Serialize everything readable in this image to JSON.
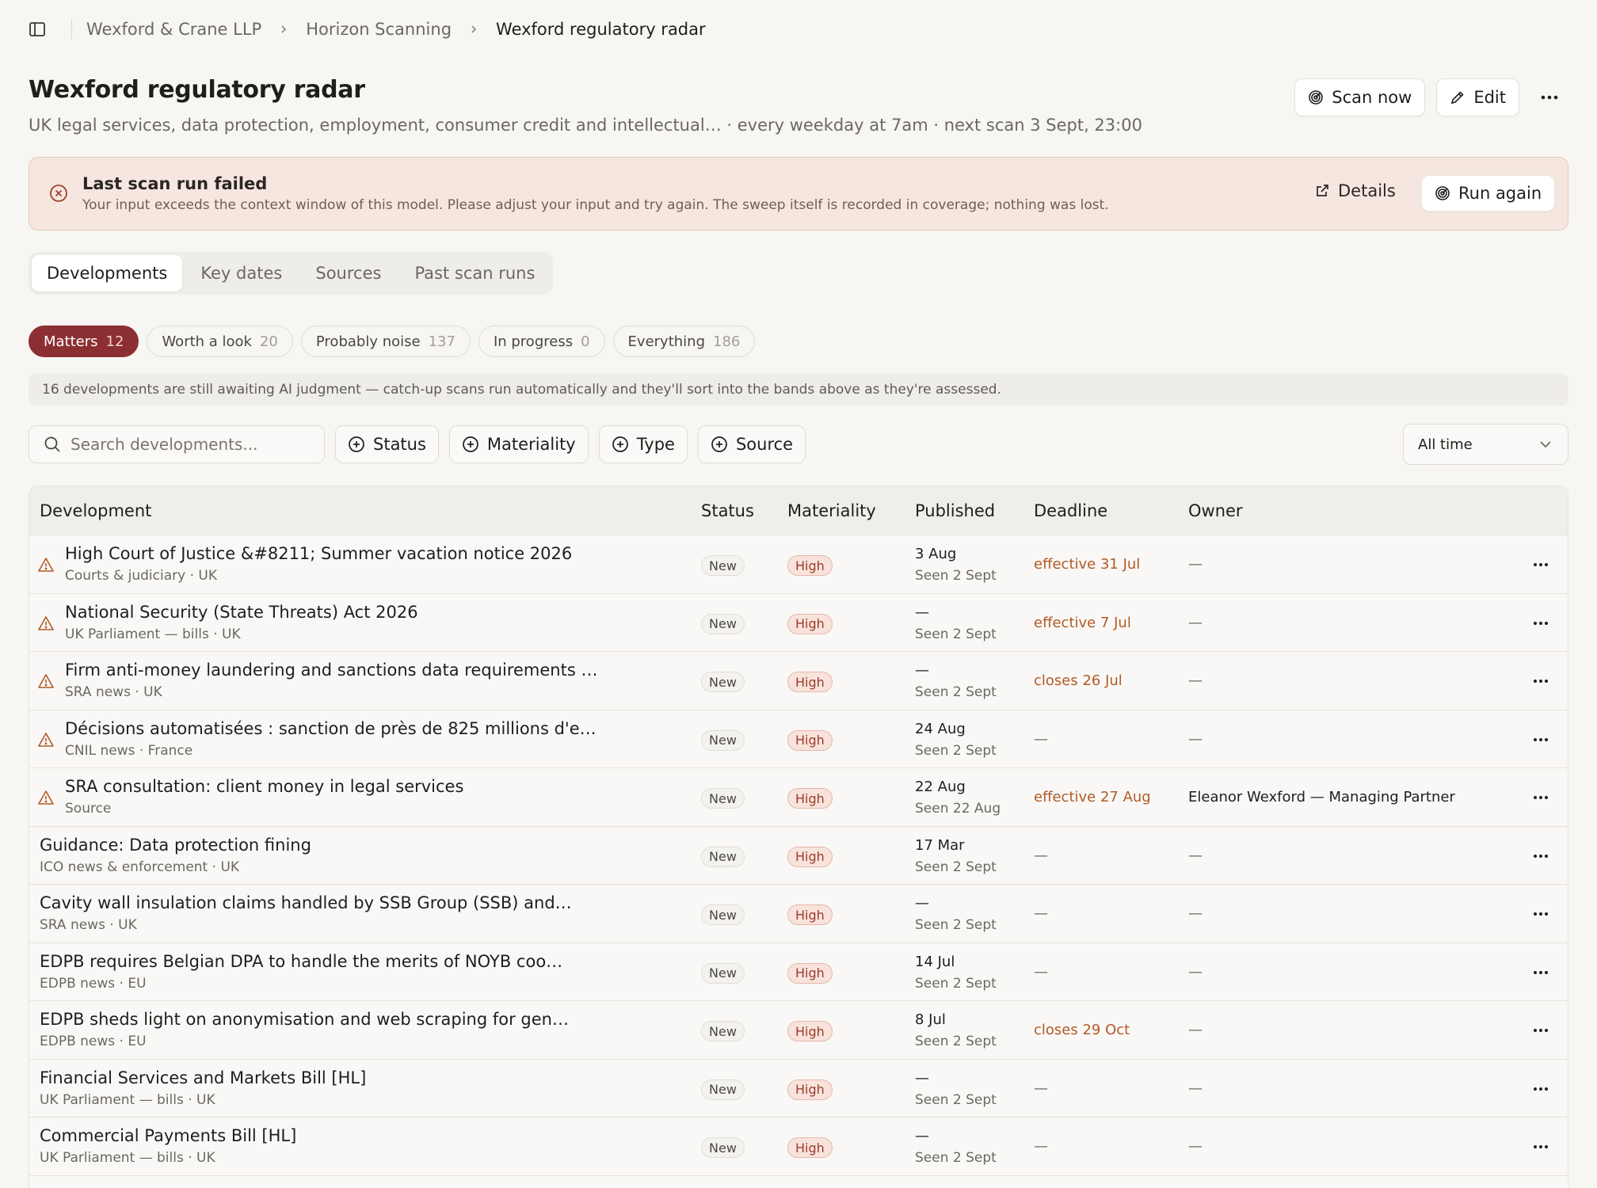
{
  "breadcrumb": {
    "items": [
      "Wexford & Crane LLP",
      "Horizon Scanning"
    ],
    "current": "Wexford regulatory radar"
  },
  "header": {
    "title": "Wexford regulatory radar",
    "subtitle": "UK legal services, data protection, employment, consumer credit and intellectual… · every weekday at 7am · next scan 3 Sept, 23:00",
    "scan_now": "Scan now",
    "edit": "Edit"
  },
  "alert": {
    "title": "Last scan run failed",
    "message": "Your input exceeds the context window of this model. Please adjust your input and try again. The sweep itself is recorded in coverage; nothing was lost.",
    "details": "Details",
    "run_again": "Run again"
  },
  "tabs": [
    "Developments",
    "Key dates",
    "Sources",
    "Past scan runs"
  ],
  "pills": [
    {
      "label": "Matters",
      "count": "12"
    },
    {
      "label": "Worth a look",
      "count": "20"
    },
    {
      "label": "Probably noise",
      "count": "137"
    },
    {
      "label": "In progress",
      "count": "0"
    },
    {
      "label": "Everything",
      "count": "186"
    }
  ],
  "notice": "16 developments are still awaiting AI judgment — catch-up scans run automatically and they'll sort into the bands above as they're assessed.",
  "search": {
    "placeholder": "Search developments..."
  },
  "filters": [
    "Status",
    "Materiality",
    "Type",
    "Source"
  ],
  "time_filter": "All time",
  "table": {
    "columns": [
      "Development",
      "Status",
      "Materiality",
      "Published",
      "Deadline",
      "Owner"
    ],
    "rows": [
      {
        "title": "High Court of Justice &#8211; Summer vacation notice 2026",
        "meta": "Courts & judiciary · UK",
        "warn": true,
        "status": "New",
        "materiality": "High",
        "published": "3 Aug",
        "seen": "Seen 2 Sept",
        "deadline": "effective 31 Jul",
        "owner": "—"
      },
      {
        "title": "National Security (State Threats) Act 2026",
        "meta": "UK Parliament — bills · UK",
        "warn": true,
        "status": "New",
        "materiality": "High",
        "published": "—",
        "seen": "Seen 2 Sept",
        "deadline": "effective 7 Jul",
        "owner": "—"
      },
      {
        "title": "Firm anti-money laundering and sanctions data requirements …",
        "meta": "SRA news · UK",
        "warn": true,
        "status": "New",
        "materiality": "High",
        "published": "—",
        "seen": "Seen 2 Sept",
        "deadline": "closes 26 Jul",
        "owner": "—"
      },
      {
        "title": "Décisions automatisées : sanction de près de 825 millions d'e…",
        "meta": "CNIL news · France",
        "warn": true,
        "status": "New",
        "materiality": "High",
        "published": "24 Aug",
        "seen": "Seen 2 Sept",
        "deadline": "—",
        "owner": "—"
      },
      {
        "title": "SRA consultation: client money in legal services",
        "meta": "Source",
        "warn": true,
        "status": "New",
        "materiality": "High",
        "published": "22 Aug",
        "seen": "Seen 22 Aug",
        "deadline": "effective 27 Aug",
        "owner": "Eleanor Wexford — Managing Partner"
      },
      {
        "title": "Guidance: Data protection fining",
        "meta": "ICO news & enforcement · UK",
        "warn": false,
        "status": "New",
        "materiality": "High",
        "published": "17 Mar",
        "seen": "Seen 2 Sept",
        "deadline": "—",
        "owner": "—"
      },
      {
        "title": "Cavity wall insulation claims handled by SSB Group (SSB) and…",
        "meta": "SRA news · UK",
        "warn": false,
        "status": "New",
        "materiality": "High",
        "published": "—",
        "seen": "Seen 2 Sept",
        "deadline": "—",
        "owner": "—"
      },
      {
        "title": "EDPB requires Belgian DPA to handle the merits of NOYB coo…",
        "meta": "EDPB news · EU",
        "warn": false,
        "status": "New",
        "materiality": "High",
        "published": "14 Jul",
        "seen": "Seen 2 Sept",
        "deadline": "—",
        "owner": "—"
      },
      {
        "title": "EDPB sheds light on anonymisation and web scraping for gen…",
        "meta": "EDPB news · EU",
        "warn": false,
        "status": "New",
        "materiality": "High",
        "published": "8 Jul",
        "seen": "Seen 2 Sept",
        "deadline": "closes 29 Oct",
        "owner": "—"
      },
      {
        "title": "Financial Services and Markets Bill [HL]",
        "meta": "UK Parliament — bills · UK",
        "warn": false,
        "status": "New",
        "materiality": "High",
        "published": "—",
        "seen": "Seen 2 Sept",
        "deadline": "—",
        "owner": "—"
      },
      {
        "title": "Commercial Payments Bill [HL]",
        "meta": "UK Parliament — bills · UK",
        "warn": false,
        "status": "New",
        "materiality": "High",
        "published": "—",
        "seen": "Seen 2 Sept",
        "deadline": "—",
        "owner": "—"
      }
    ]
  },
  "colors": {
    "accent": "#8c2f33",
    "alert_bg": "#f5e7df",
    "deadline": "#b25a25"
  }
}
